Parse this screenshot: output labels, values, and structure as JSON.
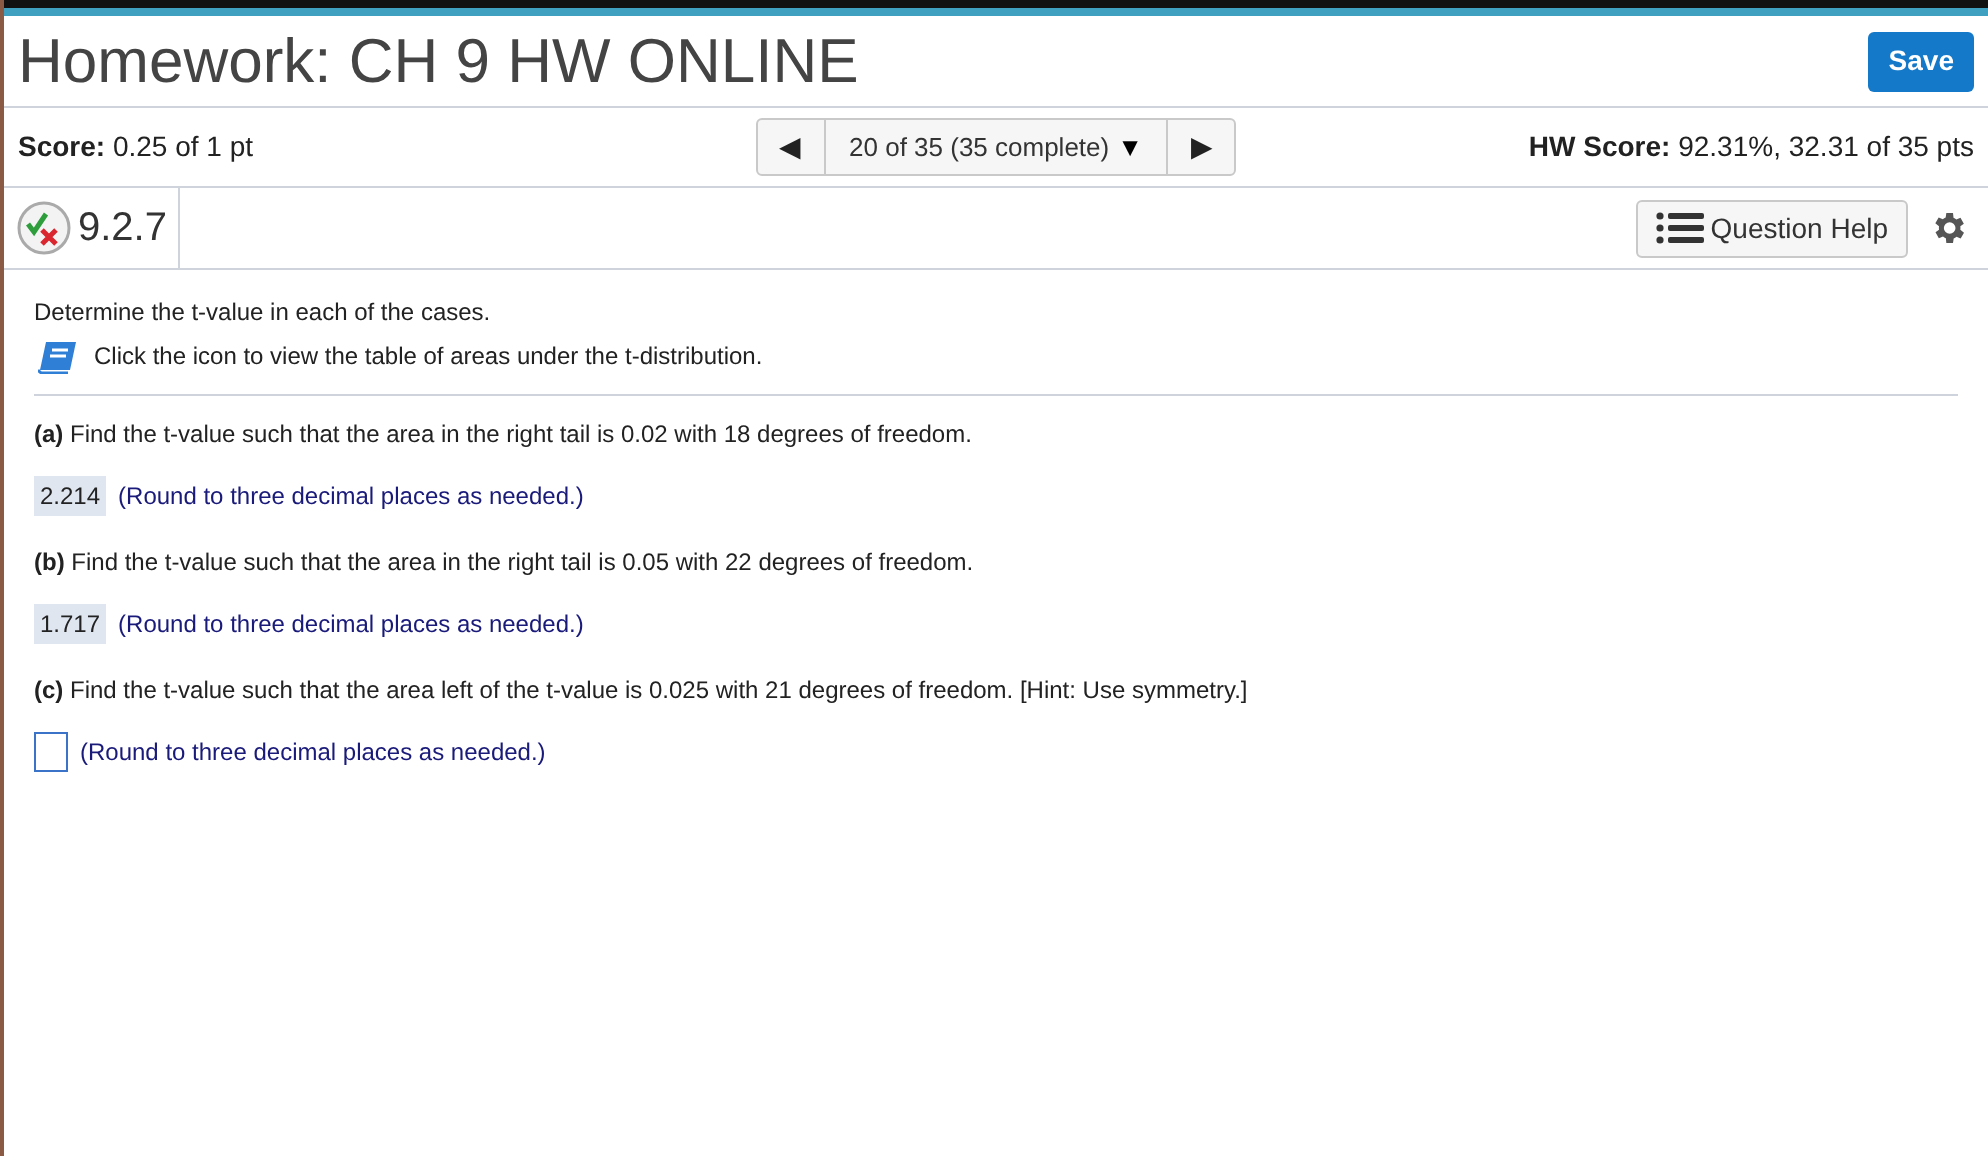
{
  "title": "Homework: CH 9 HW ONLINE",
  "save_button": "Save",
  "score": "**Score:** 0.25 of 1 pt",
  "navigator": {
    "prev": "◀",
    "current": "20 of 35 (35 complete)",
    "dropdown": "▼",
    "next": "▶"
  },
  "hw_score": "**HW Score:** 92.31%, 32.31 of 35 pts",
  "question": {
    "number": "9.2.7",
    "help_button": "Question Help"
  },
  "intro": "Determine the t-value in each of the cases.",
  "table_link": "Click the icon to view the table of areas under the t-distribution.",
  "parts": [
    {
      "prompt": "**(a)** Find the t-value such that the area in the right tail is 0.02 with 18 degrees of freedom.",
      "kind": "answered",
      "value": "2.214",
      "hint": "(Round to three decimal places as needed.)"
    },
    {
      "prompt": "**(b)** Find the t-value such that the area in the right tail is 0.05 with 22 degrees of freedom.",
      "kind": "answered",
      "value": "1.717",
      "hint": "(Round to three decimal places as needed.)"
    },
    {
      "prompt": "**(c)** Find the t-value such that the area left of the t-value is 0.025 with 21 degrees of freedom. [Hint: Use symmetry.]",
      "kind": "empty",
      "hint": "(Round to three decimal places as needed.)"
    }
  ]
}
